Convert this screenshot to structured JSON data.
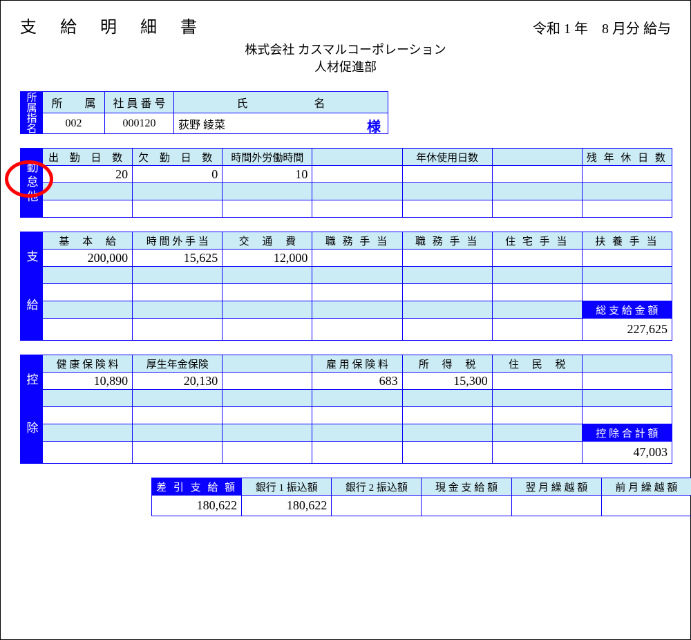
{
  "doc_title": "支 給 明 細 書",
  "period": "令和 1 年　8 月分 給与",
  "company_name": "株式会社 カスマルコーポレーション",
  "department": "人材促進部",
  "emp": {
    "side": "所属指名",
    "h_dept": "所　　属",
    "h_id": "社 員 番 号",
    "h_name": "氏　　　　　　名",
    "dept": "002",
    "id": "000120",
    "name": "荻野 綾菜",
    "sama": "様"
  },
  "kintai": {
    "side": "勤怠他",
    "headers": [
      "出 勤 日 数",
      "欠 勤 日 数",
      "時間外労働時間",
      "",
      "年休使用日数",
      "",
      "残 年 休 日 数"
    ],
    "row1": [
      "20",
      "0",
      "10",
      "",
      "",
      "",
      ""
    ]
  },
  "shikyu": {
    "side": "支　給",
    "headers": [
      "基　 本　 給",
      "時 間 外 手 当",
      "交　 通　 費",
      "職 務 手 当",
      "職 務 手 当",
      "住 宅 手 当",
      "扶 養 手 当"
    ],
    "row1": [
      "200,000",
      "15,625",
      "12,000",
      "",
      "",
      "",
      ""
    ],
    "total_label": "総 支 給 金 額",
    "total": "227,625"
  },
  "kojo": {
    "side": "控　除",
    "headers": [
      "健 康 保 険 料",
      "厚生年金保険",
      "",
      "雇 用 保 険 料",
      "所　 得　 税",
      "住　 民　 税",
      ""
    ],
    "row1": [
      "10,890",
      "20,130",
      "",
      "683",
      "15,300",
      "",
      ""
    ],
    "total_label": "控 除 合 計 額",
    "total": "47,003"
  },
  "summary": {
    "headers": [
      "差 引 支 給 額",
      "銀行 1 振込額",
      "銀行 2 振込額",
      "現 金 支 給 額",
      "翌 月 繰 越 額",
      "前 月 繰 越 額"
    ],
    "row": [
      "180,622",
      "180,622",
      "",
      "",
      "",
      ""
    ]
  }
}
